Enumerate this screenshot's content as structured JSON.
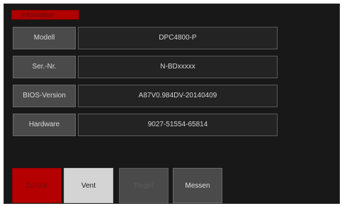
{
  "header": {
    "title": "Information"
  },
  "info_rows": [
    {
      "label": "Modell",
      "value": "DPC4800-P"
    },
    {
      "label": "Ser.-Nr.",
      "value": "N-BDxxxxx"
    },
    {
      "label": "BIOS-Version",
      "value": "A87V0.984DV-20140409"
    },
    {
      "label": "Hardware",
      "value": "9027-51554-65814"
    }
  ],
  "buttons": {
    "back": "Zurück",
    "vent": "Vent",
    "regel": "Regel",
    "messen": "Messen"
  },
  "colors": {
    "accent_red": "#b40000",
    "background": "#181818",
    "label_bg": "#4a4a4a",
    "value_bg": "#232323",
    "active_button": "#d4d4d4"
  }
}
